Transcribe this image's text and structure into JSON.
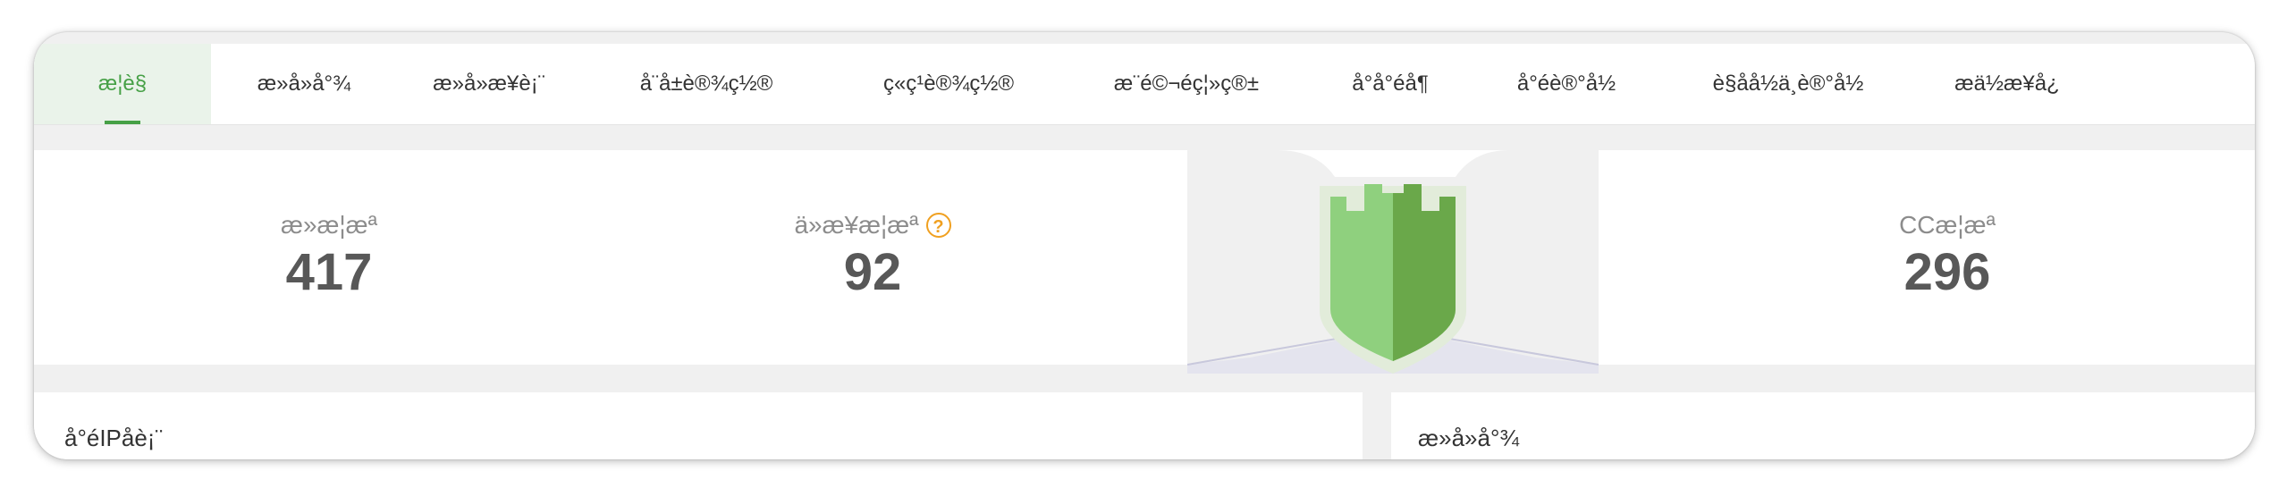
{
  "tabs": [
    {
      "label": "æ¦è§",
      "active": true
    },
    {
      "label": "æ»å»å°¾",
      "active": false
    },
    {
      "label": "æ»å»æ¥è¡¨",
      "active": false
    },
    {
      "label": "å¨å±è®¾ç½®",
      "active": false
    },
    {
      "label": "ç«ç¹è®¾ç½®",
      "active": false
    },
    {
      "label": "æ¨é©¬éç¦»ç®±",
      "active": false
    },
    {
      "label": "å°å°éå¶",
      "active": false
    },
    {
      "label": "å°éè®°å½",
      "active": false
    },
    {
      "label": "è§åå½ä¸è®°å½",
      "active": false
    },
    {
      "label": "æä½æ¥å¿",
      "active": false
    }
  ],
  "stats": {
    "total_intercept": {
      "label": "æ»æ¦æª",
      "value": "417"
    },
    "today_intercept": {
      "label": "ä»æ¥æ¦æª",
      "value": "92",
      "help_icon": "question-circle-icon"
    },
    "cc_intercept": {
      "label": "CCæ¦æª",
      "value": "296"
    }
  },
  "panels": {
    "left_title": "å°éIPåè¡¨",
    "right_title": "æ»å»å°¾"
  },
  "colors": {
    "accent": "#46a046",
    "active_tab_bg": "#eaf3ea",
    "shield_light": "#8fd07e",
    "shield_dark": "#6aa84a",
    "help": "#f0a020"
  }
}
